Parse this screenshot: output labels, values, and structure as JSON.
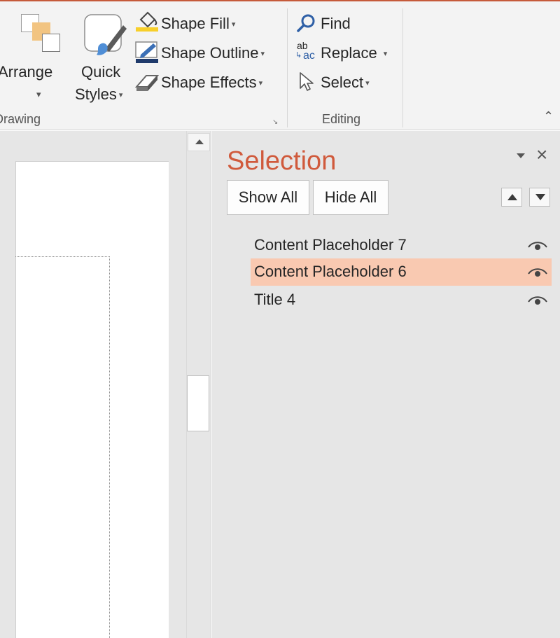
{
  "ribbon": {
    "arrange_label": "Arrange",
    "quick_label": "Quick",
    "styles_label": "Styles",
    "shape_fill_label": "Shape Fill",
    "shape_outline_label": "Shape Outline",
    "shape_effects_label": "Shape Effects",
    "find_label": "Find",
    "replace_label": "Replace",
    "select_label": "Select",
    "drawing_group_label": "Drawing",
    "editing_group_label": "Editing",
    "replace_icon_top": "ab",
    "replace_icon_bottom": "ac",
    "accent_color": "#c55a3a",
    "icons": [
      "paint-bucket-icon",
      "pencil-icon",
      "eraser-icon",
      "magnifier-icon",
      "replace-icon",
      "cursor-icon",
      "arrange-icon",
      "quick-styles-icon"
    ]
  },
  "selection_pane": {
    "title": "Selection",
    "show_all_label": "Show All",
    "hide_all_label": "Hide All",
    "title_color": "#d05a3c",
    "selected_row_color": "#f9c9b1",
    "items": [
      {
        "label": "Content Placeholder 7",
        "selected": false,
        "visible": true
      },
      {
        "label": "Content Placeholder 6",
        "selected": true,
        "visible": true
      },
      {
        "label": "Title 4",
        "selected": false,
        "visible": true
      }
    ]
  }
}
